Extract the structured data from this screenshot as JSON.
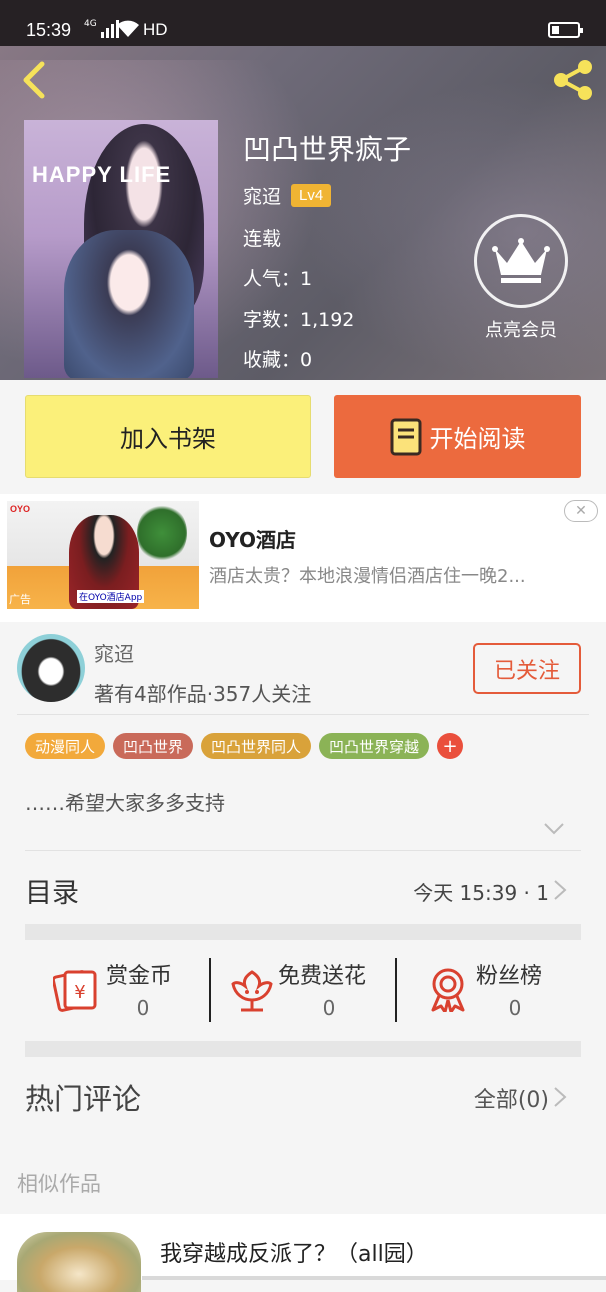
{
  "status_bar": {
    "time": "15:39",
    "network": "4G",
    "hd": "HD"
  },
  "header": {
    "back_icon": "chevron-left-icon",
    "share_icon": "share-icon"
  },
  "book": {
    "title": "凹凸世界疯子",
    "author": "窕迢",
    "level": "Lv4",
    "status": "连载",
    "popularity": "人气：1",
    "word_count": "字数：1,192",
    "favorites": "收藏：0",
    "cover_text": "HAPPY LIFE"
  },
  "vip": {
    "icon": "crown-icon",
    "label": "点亮会员"
  },
  "actions": {
    "add_shelf": "加入书架",
    "start_read": "开始阅读"
  },
  "ad": {
    "brand_logo": "OYO",
    "title": "OYO酒店",
    "description": "酒店太贵？本地浪漫情侣酒店住一晚2...",
    "ad_tag": "广告",
    "image_caption": "在OYO酒店App"
  },
  "author_info": {
    "name": "窕迢",
    "stats": "著有4部作品·357人关注",
    "follow_label": "已关注"
  },
  "tags": [
    {
      "label": "动漫同人",
      "color": "#f2a93b"
    },
    {
      "label": "凹凸世界",
      "color": "#c96a5a"
    },
    {
      "label": "凹凸世界同人",
      "color": "#d9a23a"
    },
    {
      "label": "凹凸世界穿越",
      "color": "#8bb356"
    }
  ],
  "tag_add": "+",
  "description": "……希望大家多多支持",
  "catalog": {
    "label": "目录",
    "value": "今天 15:39 · 1"
  },
  "stats": [
    {
      "label": "赏金币",
      "value": "0",
      "icon": "red-envelope-icon"
    },
    {
      "label": "免费送花",
      "value": "0",
      "icon": "flower-icon"
    },
    {
      "label": "粉丝榜",
      "value": "0",
      "icon": "award-ribbon-icon"
    }
  ],
  "comments": {
    "label": "热门评论",
    "value": "全部(0)"
  },
  "similar": {
    "label": "相似作品",
    "first_title": "我穿越成反派了？（all园）"
  },
  "colors": {
    "accent": "#ec6a3e",
    "shelf_button": "#fbf07a",
    "follow": "#e45b3a",
    "icon_red": "#d9412f"
  }
}
